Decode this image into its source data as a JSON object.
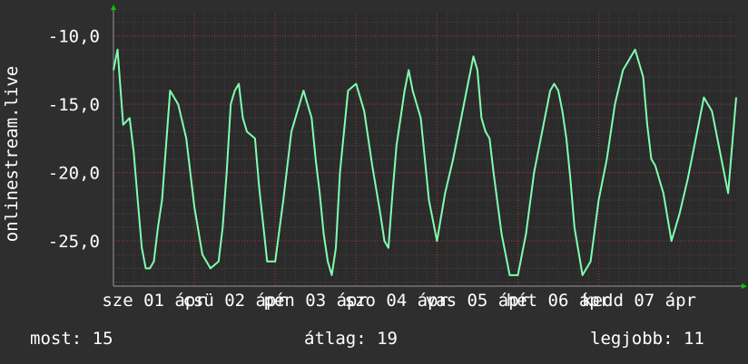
{
  "chart_data": {
    "type": "line",
    "ylabel": "onlinestream.live",
    "ylim": [
      -28.3,
      -8.3
    ],
    "yticks": [
      {
        "value": -10,
        "label": "-10,0"
      },
      {
        "value": -15,
        "label": "-15,0"
      },
      {
        "value": -20,
        "label": "-20,0"
      },
      {
        "value": -25,
        "label": "-25,0"
      }
    ],
    "xlim": [
      0,
      7.7
    ],
    "xticks": [
      {
        "value": 0.0,
        "label": "sze 01 ápr"
      },
      {
        "value": 1.0,
        "label": "csü 02 ápr"
      },
      {
        "value": 2.0,
        "label": "pén 03 ápr"
      },
      {
        "value": 3.0,
        "label": "szo 04 ápr"
      },
      {
        "value": 4.0,
        "label": "vas 05 ápr"
      },
      {
        "value": 5.0,
        "label": "hét 06 ápr"
      },
      {
        "value": 6.0,
        "label": "kedd 07 ápr"
      }
    ],
    "grid": true,
    "series": [
      {
        "color": "#7fffb0",
        "x": [
          0.0,
          0.05,
          0.12,
          0.2,
          0.25,
          0.3,
          0.35,
          0.4,
          0.45,
          0.5,
          0.55,
          0.6,
          0.7,
          0.8,
          0.9,
          1.0,
          1.1,
          1.2,
          1.3,
          1.35,
          1.4,
          1.45,
          1.5,
          1.55,
          1.6,
          1.65,
          1.75,
          1.8,
          1.9,
          2.0,
          2.1,
          2.2,
          2.3,
          2.35,
          2.4,
          2.45,
          2.5,
          2.55,
          2.6,
          2.65,
          2.7,
          2.75,
          2.8,
          2.9,
          3.0,
          3.1,
          3.2,
          3.3,
          3.35,
          3.4,
          3.45,
          3.5,
          3.55,
          3.6,
          3.65,
          3.7,
          3.8,
          3.9,
          4.0,
          4.1,
          4.2,
          4.3,
          4.35,
          4.4,
          4.45,
          4.5,
          4.55,
          4.6,
          4.65,
          4.7,
          4.8,
          4.9,
          5.0,
          5.1,
          5.2,
          5.3,
          5.4,
          5.45,
          5.5,
          5.55,
          5.6,
          5.65,
          5.7,
          5.8,
          5.9,
          6.0,
          6.1,
          6.2,
          6.3,
          6.4,
          6.45,
          6.5,
          6.55,
          6.6,
          6.65,
          6.7,
          6.8,
          6.9,
          7.0,
          7.1,
          7.2,
          7.3,
          7.4,
          7.5,
          7.6,
          7.7
        ],
        "values": [
          -12.5,
          -11.0,
          -16.5,
          -16.0,
          -18.5,
          -22.0,
          -25.5,
          -27.0,
          -27.0,
          -26.5,
          -24.0,
          -22.0,
          -14.0,
          -15.0,
          -17.5,
          -22.5,
          -26.0,
          -27.0,
          -26.5,
          -24.0,
          -20.0,
          -15.0,
          -14.0,
          -13.5,
          -16.0,
          -17.0,
          -17.5,
          -21.0,
          -26.5,
          -26.5,
          -22.0,
          -17.0,
          -15.0,
          -14.0,
          -15.0,
          -16.0,
          -19.0,
          -21.5,
          -24.5,
          -26.5,
          -27.5,
          -25.5,
          -20.0,
          -14.0,
          -13.5,
          -15.5,
          -19.5,
          -23.0,
          -25.0,
          -25.5,
          -21.5,
          -18.0,
          -16.0,
          -14.0,
          -12.5,
          -14.0,
          -16.0,
          -22.0,
          -25.0,
          -21.5,
          -19.0,
          -16.0,
          -14.5,
          -13.0,
          -11.5,
          -12.5,
          -16.0,
          -17.0,
          -17.5,
          -20.0,
          -24.5,
          -27.5,
          -27.5,
          -24.5,
          -20.0,
          -17.0,
          -14.0,
          -13.5,
          -14.0,
          -15.5,
          -17.5,
          -20.5,
          -24.0,
          -27.5,
          -26.5,
          -22.0,
          -19.0,
          -15.0,
          -12.5,
          -11.5,
          -11.0,
          -12.0,
          -13.0,
          -16.5,
          -19.0,
          -19.5,
          -21.5,
          -25.0,
          -23.0,
          -20.5,
          -17.5,
          -14.5,
          -15.5,
          -18.5,
          -21.5,
          -14.5
        ]
      }
    ]
  },
  "footer": {
    "most": "most: 15",
    "atlag": "átlag: 19",
    "legjobb": "legjobb: 11"
  }
}
